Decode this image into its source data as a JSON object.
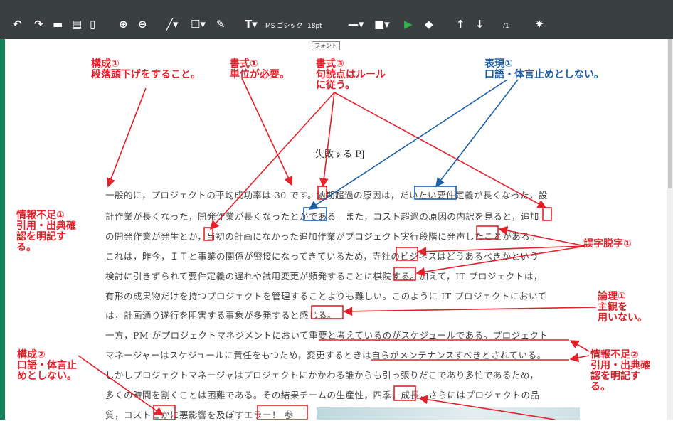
{
  "toolbar": {
    "items": [
      {
        "name": "undo-icon",
        "glyph": "↶"
      },
      {
        "name": "redo-icon",
        "glyph": "↷"
      },
      {
        "name": "open-folder-icon",
        "glyph": "▬"
      },
      {
        "name": "save-icon",
        "glyph": "▤"
      },
      {
        "name": "pdf-icon",
        "glyph": "▯"
      },
      {
        "name": "zoom-in-icon",
        "glyph": "⊕"
      },
      {
        "name": "zoom-out-icon",
        "glyph": "⊖"
      },
      {
        "name": "line-tool-icon",
        "glyph": "╱▾"
      },
      {
        "name": "rectangle-tool-icon",
        "glyph": "☐▾"
      },
      {
        "name": "pen-tool-icon",
        "glyph": "✎"
      },
      {
        "name": "text-tool-icon",
        "glyph": "T▾"
      },
      {
        "name": "line-style-icon",
        "glyph": "—▾"
      },
      {
        "name": "color-picker-icon",
        "glyph": "■▾"
      },
      {
        "name": "play-icon",
        "glyph": "▶"
      },
      {
        "name": "eraser-icon",
        "glyph": "◆"
      },
      {
        "name": "arrow-up-icon",
        "glyph": "↑"
      },
      {
        "name": "arrow-down-icon",
        "glyph": "↓"
      },
      {
        "name": "settings-gear-icon",
        "glyph": "✷"
      }
    ],
    "font_name": "MS ゴシック",
    "font_size": "18pt",
    "page_indicator": "/1",
    "accent_color": "#2fb24a"
  },
  "tooltip": "フォント",
  "document": {
    "title": "失敗する PJ",
    "lines": [
      "一般的に，プロジェクトの平均成功率は 30 です。納期超過の原因は，だいたい要件定義が長くなった，設",
      "計作業が長くなった，開発作業が長くなったとかである。また，コスト超過の原因の内訳を見ると，追加",
      "の開発作業が発生とか，当初の計画になかった追加作業がプロジェクト実行段階に発声したことがある。",
      "これは，昨今，ＩＴと事業の関係が密接になってきているため，寺社のビジネスはどうあるべきかという",
      "検討に引きずられて要件定義の遅れや試用変更が頻発することに棋院する。加えて，IT プロジェクトは，",
      "有形の成果物だけを持つプロジェクトを管理することよりも難しい。このように IT プロジェクトにおいて",
      "は，計画通り遂行を阻害する事象が多発すると感じる。",
      "一方，PM がプロジェクトマネジメントにおいて重要と考えているのがスケジュールである。プロジェクト",
      "マネージャーはスケジュールに責任をもつため，変更するときは自らがメンテナンスすべきとされている。",
      "しかしプロジェクトマネージャはプロジェクトにかかわる誰からも引っ張りだこであり多忙であるため，",
      "多くの時間を割くことは困難である。その結果チームの生産性，四季，成長，さらにはプロジェクトの品",
      "質，コストとかに悪影響を及ぼすエラー！ 参"
    ]
  },
  "annotations": {
    "kousei1": "構成①\n段落頭下げをすること。",
    "shoshiki1": "書式①\n単位が必要。",
    "shoshiki3": "書式③\n句読点はルール\nに従う。",
    "hyougen1": "表現①\n口語・体言止めとしない。",
    "joho1": "情報不足①\n引用・出典確\n認を明記す\nる。",
    "goji1": "誤字脱字①",
    "ronri1": "論理①\n主観を\n用いない。",
    "kousei2": "構成②\n口語・体言止\nめとしない。",
    "joho2": "情報不足②\n引用・出典確\n認を明記す\nる。"
  },
  "colors": {
    "toolbar_bg": "#3a3f41",
    "annotation_red": "#e4202a",
    "annotation_blue": "#1a5fa8",
    "frame_green": "#14855a"
  }
}
